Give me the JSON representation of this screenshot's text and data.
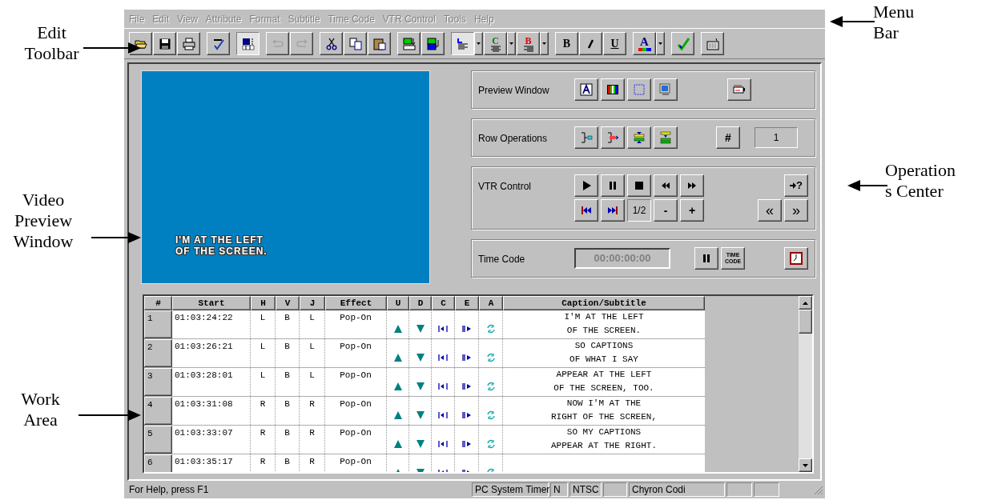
{
  "callouts": [
    {
      "kind": "left",
      "text": "Edit\nToolbar"
    },
    {
      "kind": "left",
      "text": "Video\nPreview\nWindow"
    },
    {
      "kind": "left",
      "text": "Work\nArea"
    },
    {
      "kind": "right",
      "text": "Menu\nBar"
    },
    {
      "kind": "right",
      "text": "Operation\ns Center"
    }
  ],
  "menu_bar": [
    {
      "label": "File",
      "disabled": true
    },
    {
      "label": "Edit",
      "disabled": true
    },
    {
      "label": "View",
      "disabled": true
    },
    {
      "label": "Attribute",
      "disabled": true
    },
    {
      "label": "Format",
      "disabled": true
    },
    {
      "label": "Subtitle",
      "disabled": true
    },
    {
      "label": "Time Code",
      "disabled": true
    },
    {
      "label": "VTR Control",
      "disabled": true
    },
    {
      "label": "Tools",
      "disabled": true
    },
    {
      "label": "Help",
      "disabled": true
    }
  ],
  "toolbar": [
    [
      {
        "kind": "open",
        "pressed": false,
        "disabled": false,
        "dropdown": false
      },
      {
        "kind": "save",
        "pressed": false,
        "disabled": false,
        "dropdown": false
      },
      {
        "kind": "print",
        "pressed": false,
        "disabled": false,
        "dropdown": false
      }
    ],
    [
      {
        "kind": "spell",
        "pressed": false,
        "disabled": false,
        "dropdown": false
      }
    ],
    [
      {
        "kind": "grid",
        "pressed": true,
        "disabled": false,
        "dropdown": false
      }
    ],
    [
      {
        "kind": "undo",
        "pressed": false,
        "disabled": true,
        "dropdown": false
      },
      {
        "kind": "redo",
        "pressed": false,
        "disabled": true,
        "dropdown": false
      }
    ],
    [
      {
        "kind": "cut",
        "pressed": false,
        "disabled": false,
        "dropdown": false
      },
      {
        "kind": "copy",
        "pressed": false,
        "disabled": false,
        "dropdown": false
      },
      {
        "kind": "paste",
        "pressed": false,
        "disabled": false,
        "dropdown": false
      }
    ],
    [
      {
        "kind": "import",
        "pressed": false,
        "disabled": false,
        "dropdown": false
      },
      {
        "kind": "export",
        "pressed": false,
        "disabled": false,
        "dropdown": false
      }
    ],
    [
      {
        "kind": "align-left",
        "pressed": true,
        "disabled": false,
        "dropdown": true
      },
      {
        "kind": "align-center",
        "label": "C",
        "pressed": false,
        "disabled": false,
        "dropdown": true
      },
      {
        "kind": "align-right",
        "label": "B",
        "pressed": false,
        "disabled": false,
        "dropdown": true
      }
    ],
    [
      {
        "kind": "bold",
        "label": "B",
        "pressed": false,
        "disabled": false,
        "dropdown": false
      },
      {
        "kind": "italic",
        "pressed": false,
        "disabled": false,
        "dropdown": false
      },
      {
        "kind": "underline",
        "label": "U",
        "pressed": false,
        "disabled": false,
        "dropdown": false
      }
    ],
    [
      {
        "kind": "font-color",
        "label": "A",
        "pressed": false,
        "disabled": false,
        "dropdown": true
      }
    ],
    [
      {
        "kind": "verify",
        "pressed": false,
        "disabled": false,
        "dropdown": false
      }
    ],
    [
      {
        "kind": "keyboard",
        "pressed": false,
        "disabled": false,
        "dropdown": false
      }
    ]
  ],
  "video_preview": {
    "caption": "I'M AT THE LEFT\nOF THE SCREEN."
  },
  "preview_window": {
    "title": "Preview Window",
    "buttons": [
      {
        "kind": "text-style"
      },
      {
        "kind": "color-bars"
      },
      {
        "kind": "safe-area"
      },
      {
        "kind": "monitor"
      }
    ],
    "extra_button": {
      "kind": "device"
    }
  },
  "row_operations": {
    "title": "Row Operations",
    "buttons": [
      {
        "kind": "insert-row"
      },
      {
        "kind": "append-row"
      },
      {
        "kind": "split-row"
      },
      {
        "kind": "merge-row"
      }
    ],
    "number_button": "#",
    "row_field": "1"
  },
  "vtr_control": {
    "title": "VTR Control",
    "transport": [
      {
        "kind": "play"
      },
      {
        "kind": "pause"
      },
      {
        "kind": "stop"
      },
      {
        "kind": "rewind"
      },
      {
        "kind": "fast-forward"
      }
    ],
    "help_button": "?",
    "marks": [
      {
        "kind": "prev-mark"
      },
      {
        "kind": "next-mark"
      }
    ],
    "speed": "1/2",
    "minus": "-",
    "plus": "+",
    "back": "«",
    "forward": "»"
  },
  "time_code": {
    "title": "Time Code",
    "value": "00:00:00:00",
    "disabled": true,
    "time_code_button": "TIME\nCODE"
  },
  "grid": {
    "columns": [
      "#",
      "Start",
      "H",
      "V",
      "J",
      "Effect",
      "U",
      "D",
      "C",
      "E",
      "A",
      "Caption/Subtitle"
    ],
    "rows": [
      {
        "number": "1",
        "start": "01:03:24:22",
        "h": "L",
        "v": "B",
        "j": "L",
        "effect": "Pop-On",
        "caption": "I'M AT THE LEFT\nOF THE SCREEN."
      },
      {
        "number": "2",
        "start": "01:03:26:21",
        "h": "L",
        "v": "B",
        "j": "L",
        "effect": "Pop-On",
        "caption": "SO CAPTIONS\nOF WHAT I SAY"
      },
      {
        "number": "3",
        "start": "01:03:28:01",
        "h": "L",
        "v": "B",
        "j": "L",
        "effect": "Pop-On",
        "caption": "APPEAR AT THE LEFT\nOF THE SCREEN, TOO."
      },
      {
        "number": "4",
        "start": "01:03:31:08",
        "h": "R",
        "v": "B",
        "j": "R",
        "effect": "Pop-On",
        "caption": "NOW I'M AT THE\nRIGHT OF THE SCREEN,"
      },
      {
        "number": "5",
        "start": "01:03:33:07",
        "h": "R",
        "v": "B",
        "j": "R",
        "effect": "Pop-On",
        "caption": "SO MY CAPTIONS\nAPPEAR AT THE RIGHT."
      },
      {
        "number": "6",
        "start": "01:03:35:17",
        "h": "R",
        "v": "B",
        "j": "R",
        "effect": "Pop-On"
      }
    ]
  },
  "status_bar": [
    {
      "kind": "text",
      "text": "For Help, press F1"
    },
    {
      "kind": "text",
      "text": "PC System Timer"
    },
    {
      "kind": "text",
      "text": "N"
    },
    {
      "kind": "text",
      "text": "NTSC"
    },
    {
      "kind": "blank"
    },
    {
      "kind": "text",
      "text": "Chyron Codi"
    },
    {
      "kind": "blank"
    },
    {
      "kind": "blank"
    }
  ]
}
